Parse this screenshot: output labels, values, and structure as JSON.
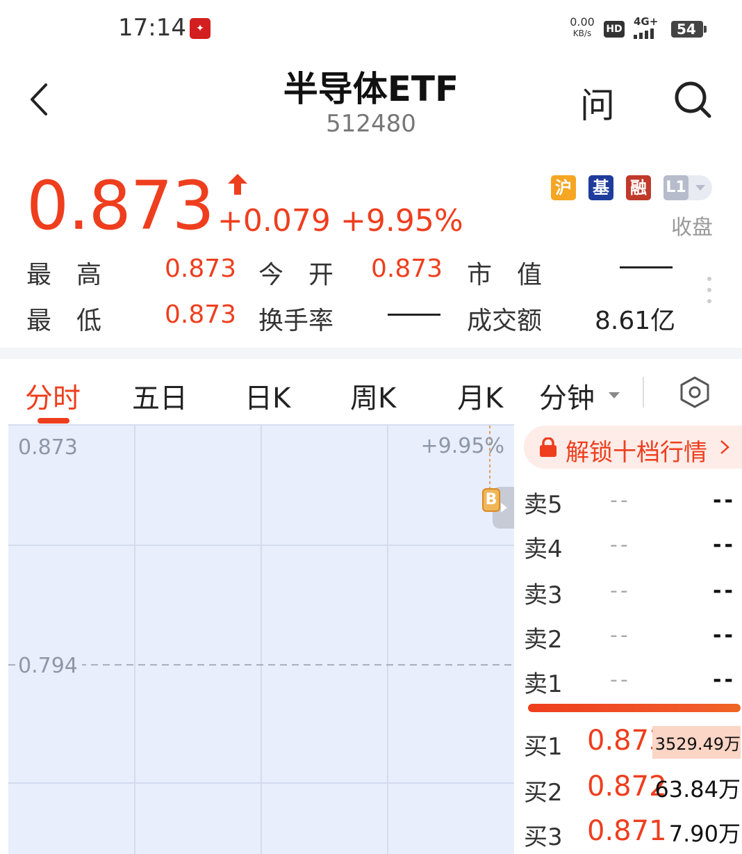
{
  "status_bar": {
    "time": "17:14",
    "speed_value": "0.00",
    "speed_unit": "KB/s",
    "hd": "HD",
    "network": "4G+",
    "battery": "54"
  },
  "header": {
    "back_icon": "chevron-left-icon",
    "title": "半导体ETF",
    "code": "512480",
    "ask_label": "问",
    "search_icon": "search-icon"
  },
  "quote": {
    "price": "0.873",
    "change": "+0.079",
    "change_pct": "+9.95%",
    "direction_icon": "up-arrow-icon",
    "badges": [
      "沪",
      "基",
      "融",
      "L1"
    ],
    "market_status": "收盘",
    "stats": {
      "high_label": "最　高",
      "high_value": "0.873",
      "open_label": "今　开",
      "open_value": "0.873",
      "mktcap_label": "市　值",
      "mktcap_value": "——",
      "low_label": "最　低",
      "low_value": "0.873",
      "turnover_label": "换手率",
      "turnover_value": "——",
      "amount_label": "成交额",
      "amount_value": "8.61亿"
    }
  },
  "tabs": {
    "items": [
      "分时",
      "五日",
      "日K",
      "周K",
      "月K",
      "分钟"
    ],
    "active": "分时",
    "settings_icon": "hexagon-settings-icon"
  },
  "chart_data": {
    "type": "line",
    "y_ticks": [
      "0.873",
      "0.794"
    ],
    "right_label": "+9.95%",
    "prev_close": 0.794,
    "ylim": [
      0.715,
      0.873
    ],
    "marker": "B",
    "series": []
  },
  "order_book": {
    "unlock_label": "解锁十档行情",
    "asks": [
      {
        "label": "卖5",
        "price": "--",
        "volume": "--"
      },
      {
        "label": "卖4",
        "price": "--",
        "volume": "--"
      },
      {
        "label": "卖3",
        "price": "--",
        "volume": "--"
      },
      {
        "label": "卖2",
        "price": "--",
        "volume": "--"
      },
      {
        "label": "卖1",
        "price": "--",
        "volume": "--"
      }
    ],
    "bids": [
      {
        "label": "买1",
        "price": "0.873",
        "volume": "3529.49万"
      },
      {
        "label": "买2",
        "price": "0.872",
        "volume": "63.84万"
      },
      {
        "label": "买3",
        "price": "0.871",
        "volume": "7.90万"
      }
    ]
  },
  "colors": {
    "up": "#ee3e1e",
    "chart_bg": "#e8eefc",
    "muted": "#8e97a8"
  }
}
